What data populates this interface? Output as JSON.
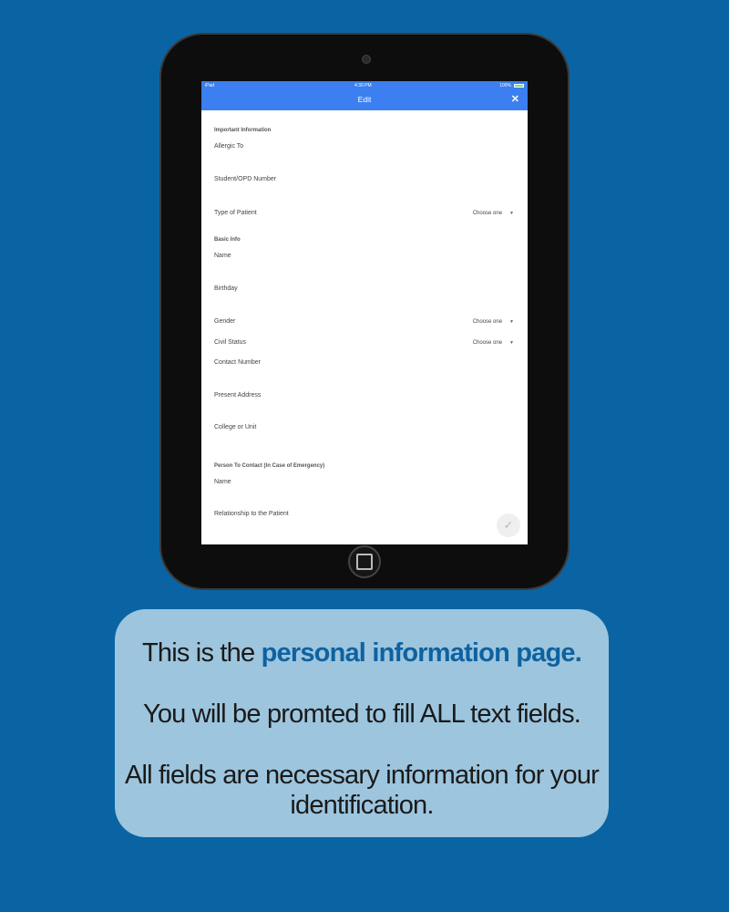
{
  "status_bar": {
    "carrier": "iPad",
    "time": "4:30 PM",
    "battery": "100%"
  },
  "nav": {
    "title": "Edit",
    "close_symbol": "✕"
  },
  "form": {
    "important_section": "Important Information",
    "allergic_to": "Allergic To",
    "student_opd_number": "Student/OPD Number",
    "type_of_patient": "Type of Patient",
    "type_of_patient_value": "Choose one",
    "basic_section": "Basic Info",
    "name": "Name",
    "birthday": "Birthday",
    "gender": "Gender",
    "gender_value": "Choose one",
    "civil_status": "Civil Status",
    "civil_status_value": "Choose one",
    "contact_number": "Contact Number",
    "present_address": "Present Address",
    "college_or_unit": "College or Unit",
    "emergency_section": "Person To Contact (In Case of Emergency)",
    "emergency_name": "Name",
    "relationship": "Relationship to the Patient",
    "submit_symbol": "✓"
  },
  "caption": {
    "line1_prefix": "This is the ",
    "line1_highlight": "personal information page.",
    "line2": "You will be promted to fill ALL text fields.",
    "line3": "All fields are necessary information for your identification."
  },
  "colors": {
    "background": "#0a64a3",
    "app_bar": "#3b7ff0",
    "caption_box": "#9dc5de",
    "highlight": "#0e62a0"
  }
}
